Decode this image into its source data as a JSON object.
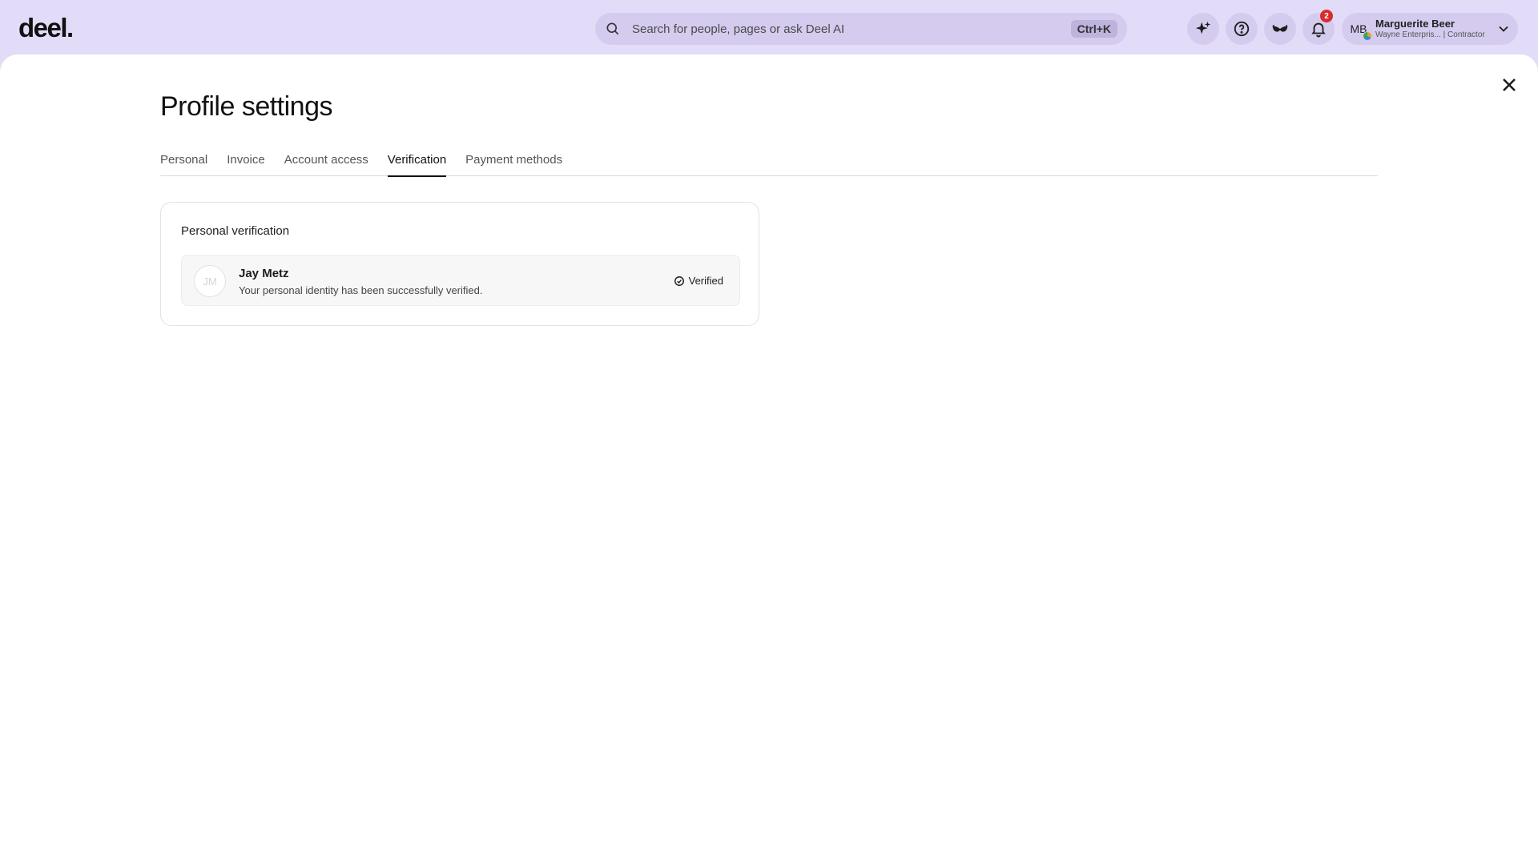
{
  "header": {
    "logo_text": "deel.",
    "search": {
      "placeholder": "Search for people, pages or ask Deel AI",
      "shortcut": "Ctrl+K"
    },
    "notifications_count": "2",
    "user": {
      "initials": "MB",
      "name": "Marguerite Beer",
      "subtitle": "Wayne Enterpris... | Contractor"
    },
    "icons": [
      "sparkle-icon",
      "help-icon",
      "mask-icon",
      "bell-icon",
      "chevron-down-icon"
    ]
  },
  "page": {
    "title": "Profile settings",
    "tabs": [
      {
        "label": "Personal",
        "active": false
      },
      {
        "label": "Invoice",
        "active": false
      },
      {
        "label": "Account access",
        "active": false
      },
      {
        "label": "Verification",
        "active": true
      },
      {
        "label": "Payment methods",
        "active": false
      }
    ]
  },
  "verification": {
    "section_title": "Personal verification",
    "person": {
      "initials": "JM",
      "name": "Jay Metz",
      "description": "Your personal identity has been successfully verified.",
      "status": "Verified"
    }
  },
  "colors": {
    "header_bg": "#e3dcf8",
    "badge": "#d62d2d"
  }
}
